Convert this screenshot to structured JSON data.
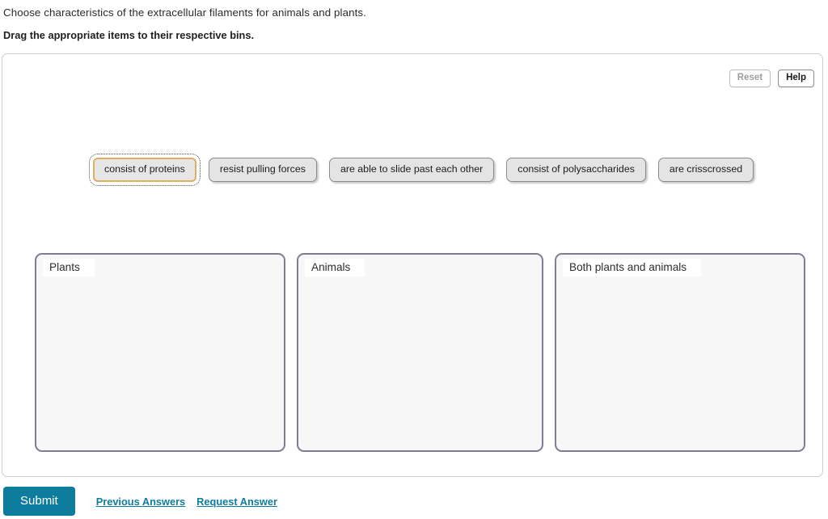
{
  "prompt": {
    "question": "Choose characteristics of the extracellular filaments for animals and plants.",
    "instruction": "Drag the appropriate items to their respective bins."
  },
  "toolbar": {
    "reset_label": "Reset",
    "help_label": "Help"
  },
  "drag_items": [
    {
      "label": "consist of proteins",
      "selected": true
    },
    {
      "label": "resist pulling forces",
      "selected": false
    },
    {
      "label": "are able to slide past each other",
      "selected": false
    },
    {
      "label": "consist of polysaccharides",
      "selected": false
    },
    {
      "label": "are crisscrossed",
      "selected": false
    }
  ],
  "bins": [
    {
      "label": "Plants",
      "items": []
    },
    {
      "label": "Animals",
      "items": []
    },
    {
      "label": "Both plants and animals",
      "items": []
    }
  ],
  "footer": {
    "submit_label": "Submit",
    "previous_answers_label": "Previous Answers",
    "request_answer_label": "Request Answer"
  },
  "colors": {
    "accent_teal": "#0e7d9d",
    "bin_border": "#7d7d93",
    "bin_fill": "#f7f7f7",
    "item_fill": "#e4e4e4",
    "item_border": "#8a8a93",
    "selection_highlight": "#e0ad62",
    "panel_border": "#cfcfcf"
  }
}
